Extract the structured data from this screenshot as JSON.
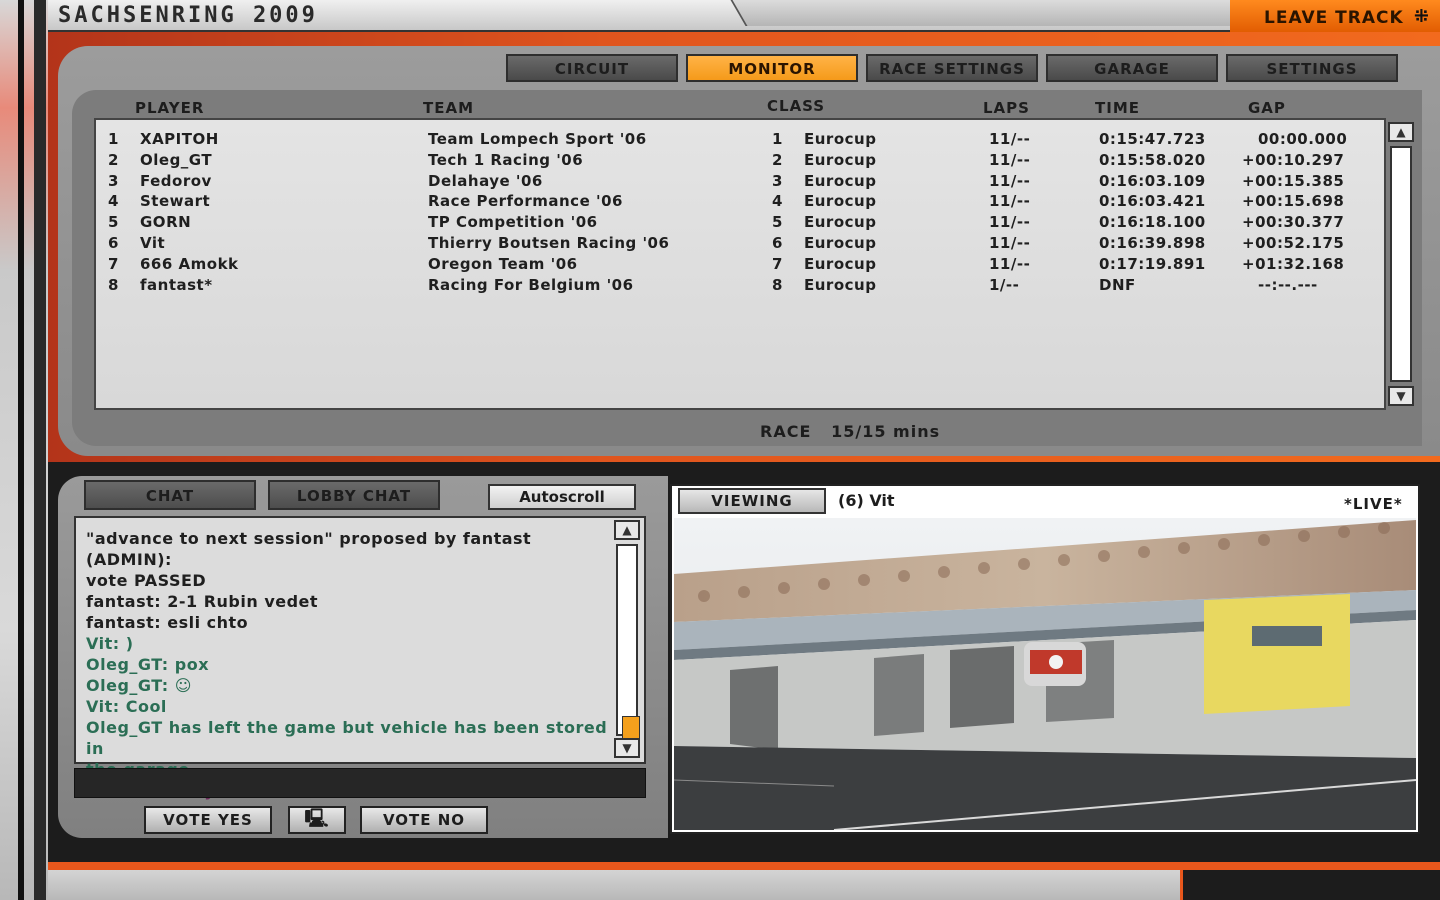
{
  "title_bar": {
    "track_name": "SACHSENRING 2009",
    "leave_track": "LEAVE TRACK"
  },
  "tabs": [
    {
      "label": "CIRCUIT",
      "active": false
    },
    {
      "label": "MONITOR",
      "active": true
    },
    {
      "label": "RACE SETTINGS",
      "active": false
    },
    {
      "label": "GARAGE",
      "active": false
    },
    {
      "label": "SETTINGS",
      "active": false
    }
  ],
  "standings": {
    "headers": {
      "player": "PLAYER",
      "team": "TEAM",
      "class": "CLASS",
      "laps": "LAPS",
      "time": "TIME",
      "gap": "GAP"
    },
    "rows": [
      {
        "pos": "1",
        "player": "XAPITOH",
        "team": "Team Lompech Sport '06",
        "class_pos": "1",
        "class": "Eurocup",
        "laps": "11/--",
        "time": "0:15:47.723",
        "gap": "00:00.000"
      },
      {
        "pos": "2",
        "player": "Oleg_GT",
        "team": "Tech 1 Racing '06",
        "class_pos": "2",
        "class": "Eurocup",
        "laps": "11/--",
        "time": "0:15:58.020",
        "gap": "+00:10.297"
      },
      {
        "pos": "3",
        "player": "Fedorov",
        "team": "Delahaye '06",
        "class_pos": "3",
        "class": "Eurocup",
        "laps": "11/--",
        "time": "0:16:03.109",
        "gap": "+00:15.385"
      },
      {
        "pos": "4",
        "player": "Stewart",
        "team": "Race Performance '06",
        "class_pos": "4",
        "class": "Eurocup",
        "laps": "11/--",
        "time": "0:16:03.421",
        "gap": "+00:15.698"
      },
      {
        "pos": "5",
        "player": "GORN",
        "team": "TP Competition '06",
        "class_pos": "5",
        "class": "Eurocup",
        "laps": "11/--",
        "time": "0:16:18.100",
        "gap": "+00:30.377"
      },
      {
        "pos": "6",
        "player": "Vit",
        "team": "Thierry Boutsen Racing '06",
        "class_pos": "6",
        "class": "Eurocup",
        "laps": "11/--",
        "time": "0:16:39.898",
        "gap": "+00:52.175"
      },
      {
        "pos": "7",
        "player": "666 Amokk",
        "team": "Oregon Team '06",
        "class_pos": "7",
        "class": "Eurocup",
        "laps": "11/--",
        "time": "0:17:19.891",
        "gap": "+01:32.168"
      },
      {
        "pos": "8",
        "player": "fantast*",
        "team": "Racing For Belgium '06",
        "class_pos": "8",
        "class": "Eurocup",
        "laps": "1/--",
        "time": "DNF",
        "gap": "--:--.---"
      }
    ]
  },
  "race_info": {
    "session": "RACE",
    "progress": "15/15 mins"
  },
  "chat": {
    "tabs": [
      "CHAT",
      "LOBBY CHAT"
    ],
    "autoscroll_label": "Autoscroll",
    "lines": [
      {
        "text": "\"advance to next session\" proposed by fantast (ADMIN):",
        "style": "sys"
      },
      {
        "text": "vote PASSED",
        "style": "sys"
      },
      {
        "text": "fantast: 2-1 Rubin vedet",
        "style": "sys"
      },
      {
        "text": "fantast: esli chto",
        "style": "sys"
      },
      {
        "text": "Vit: )",
        "style": "green"
      },
      {
        "text": "Oleg_GT: pox",
        "style": "green"
      },
      {
        "text": "Oleg_GT: ☺",
        "style": "green"
      },
      {
        "text": "Vit: Cool",
        "style": "green"
      },
      {
        "text": "Oleg_GT has left the game but vehicle has been stored in",
        "style": "green"
      },
      {
        "text": "the garage",
        "style": "green"
      },
      {
        "text": "Stewart: very cool",
        "style": "purple"
      }
    ],
    "vote_yes": "VOTE YES",
    "vote_no": "VOTE NO"
  },
  "viewing": {
    "button_label": "VIEWING",
    "target": "(6) Vit",
    "live": "*LIVE*"
  }
}
